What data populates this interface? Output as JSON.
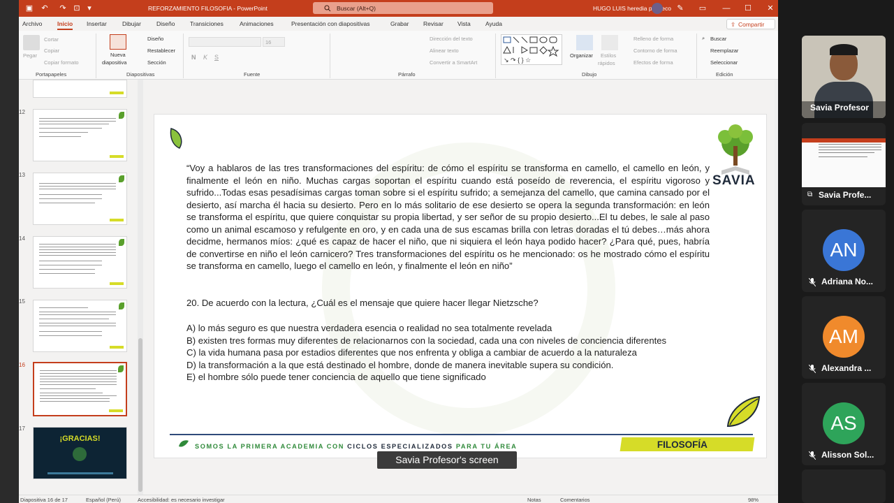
{
  "app": {
    "title": "REFORZAMIENTO FILOSOFIA  -  PowerPoint",
    "search_placeholder": "Buscar (Alt+Q)",
    "user": "HUGO LUIS heredia pacheco",
    "share_label": "Compartir"
  },
  "menu": [
    "Archivo",
    "Inicio",
    "Insertar",
    "Dibujar",
    "Diseño",
    "Transiciones",
    "Animaciones",
    "Presentación con diapositivas",
    "Grabar",
    "Revisar",
    "Vista",
    "Ayuda"
  ],
  "ribbon": {
    "portapapeles": {
      "label": "Portapapeles",
      "pegar": "Pegar",
      "cortar": "Cortar",
      "copiar": "Copiar",
      "copiar_formato": "Copiar formato"
    },
    "diapositivas": {
      "label": "Diapositivas",
      "nueva": "Nueva",
      "diapositiva": "diapositiva",
      "diseno": "Diseño",
      "restablecer": "Restablecer",
      "seccion": "Sección"
    },
    "fuente": {
      "label": "Fuente",
      "size": "16"
    },
    "parrafo": {
      "label": "Párrafo",
      "direccion": "Dirección del texto",
      "alinear": "Alinear texto",
      "convertir": "Convertir a SmartArt"
    },
    "dibujo": {
      "label": "Dibujo",
      "organizar": "Organizar",
      "estilos": "Estilos",
      "rapidos": "rápidos",
      "relleno": "Relleno de forma",
      "contorno": "Contorno de forma",
      "efectos": "Efectos de forma"
    },
    "edicion": {
      "label": "Edición",
      "buscar": "Buscar",
      "reemplazar": "Reemplazar",
      "seleccionar": "Seleccionar"
    }
  },
  "thumbnails": [
    {
      "num": "12"
    },
    {
      "num": "13"
    },
    {
      "num": "14"
    },
    {
      "num": "15"
    },
    {
      "num": "16"
    },
    {
      "num": "17",
      "title": "¡GRACIAS!"
    }
  ],
  "slide": {
    "quote": "“Voy a hablaros de las tres transformaciones del espíritu: de cómo el espíritu se transforma en camello, el camello en león, y finalmente el león en niño. Muchas cargas soportan el espíritu cuando está poseído de reverencia, el espíritu vigoroso y sufrido...Todas esas pesadísimas cargas toman sobre si el espíritu sufrido; a semejanza del camello, que camina cansado por el desierto, así marcha él hacia su desierto. Pero en lo más solitario de ese desierto se opera la segunda transformación: en león se transforma el espíritu, que quiere conquistar su propia libertad, y ser señor de su propio desierto...El tu debes, le sale al paso como un animal escamoso y refulgente en oro, y en cada una de sus escamas brilla con letras doradas el tú debes…más ahora decidme, hermanos míos: ¿qué es capaz de hacer el niño, que ni siquiera el león haya podido hacer? ¿Para qué, pues, habría de convertirse en niño el león carnicero? Tres transformaciones del espíritu os he mencionado: os he mostrado cómo el espíritu se transforma en camello, luego el camello en león, y finalmente el león en niño”",
    "question": "20. De acuerdo con la lectura, ¿Cuál es el mensaje que quiere hacer llegar Nietzsche?",
    "options": [
      "A) lo más seguro es que nuestra verdadera esencia o realidad no sea totalmente revelada",
      "B) existen tres formas muy diferentes de relacionarnos con la sociedad, cada una con niveles de conciencia diferentes",
      "C) la vida humana pasa por estadios diferentes que nos enfrenta y obliga a cambiar de acuerdo a la naturaleza",
      "D) la transformación a la que está destinado el hombre, donde de manera inevitable supera su condición.",
      "E) el hombre sólo puede tener conciencia de aquello que tiene significado"
    ],
    "logo": "SAVIA",
    "footer_pre": "SOMOS LA PRIMERA ACADEMIA CON ",
    "footer_em": "CICLOS ESPECIALIZADOS",
    "footer_post": " PARA TU ÁREA",
    "footer_tag": "FILOSOFÍA"
  },
  "screen_share_label": "Savia Profesor's screen",
  "statusbar": {
    "slide_of": "Diapositiva 16 de 17",
    "lang": "Español (Perú)",
    "access": "Accesibilidad: es necesario investigar",
    "notes": "Notas",
    "comments": "Comentarios",
    "zoom": "98%"
  },
  "participants": [
    {
      "name": "Savia Profesor",
      "type": "video"
    },
    {
      "name": "Savia Profe...",
      "type": "screen"
    },
    {
      "name": "Adriana No...",
      "initials": "AN",
      "color": "#3a76d6",
      "muted": true
    },
    {
      "name": "Alexandra ...",
      "initials": "AM",
      "color": "#f08a2c",
      "muted": true
    },
    {
      "name": "Alisson Sol...",
      "initials": "AS",
      "color": "#2ea45a",
      "muted": true
    }
  ]
}
